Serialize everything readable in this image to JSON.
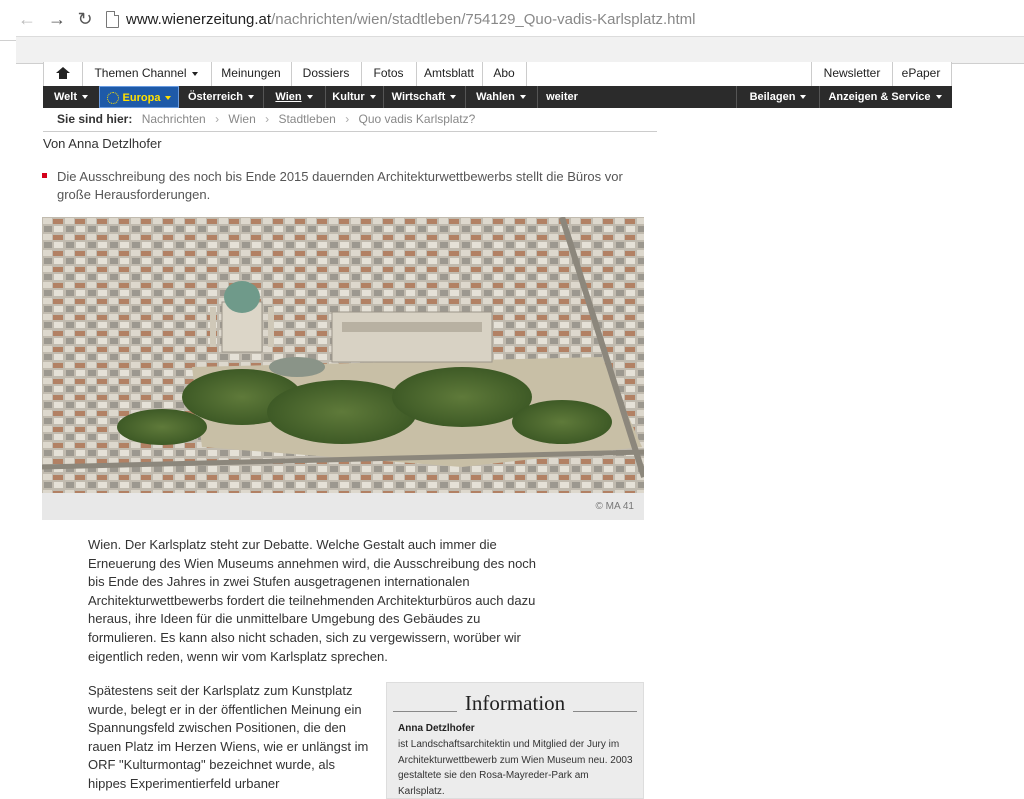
{
  "browser": {
    "url_host": "www.wienerzeitung.at",
    "url_path": "/nachrichten/wien/stadtleben/754129_Quo-vadis-Karlsplatz.html"
  },
  "topnav": {
    "items": [
      "Themen Channel",
      "Meinungen",
      "Dossiers",
      "Fotos",
      "Amtsblatt",
      "Abo"
    ],
    "right": [
      "Newsletter",
      "ePaper"
    ]
  },
  "darknav": {
    "items": [
      "Welt",
      "Europa",
      "Österreich",
      "Wien",
      "Kultur",
      "Wirtschaft",
      "Wahlen",
      "weiter"
    ],
    "right": [
      "Beilagen",
      "Anzeigen & Service"
    ]
  },
  "breadcrumb": {
    "label": "Sie sind hier:",
    "items": [
      "Nachrichten",
      "Wien",
      "Stadtleben",
      "Quo vadis Karlsplatz?"
    ]
  },
  "article": {
    "author": "Von Anna Detzlhofer",
    "teaser": "Die Ausschreibung des noch bis Ende 2015 dauernden Architekturwettbewerbs stellt die Büros vor große Herausforderungen.",
    "photo_credit": "© MA 41",
    "para1": "Wien. Der Karlsplatz steht zur Debatte. Welche Gestalt auch immer die Erneuerung des Wien Museums annehmen wird, die Ausschreibung des noch bis Ende des Jahres in zwei Stufen ausgetragenen internationalen Architekturwettbewerbs fordert die teilnehmenden Architekturbüros auch dazu heraus, ihre Ideen für die unmittelbare Umgebung des Gebäudes zu formulieren. Es kann also nicht schaden, sich zu vergewissern, worüber wir eigentlich reden, wenn wir vom Karlsplatz sprechen.",
    "para2": "Spätestens seit der Karlsplatz zum Kunstplatz wurde, belegt er in der öffentlichen Meinung ein Spannungsfeld zwischen Positionen, die den rauen Platz im Herzen Wiens, wie er unlängst im ORF \"Kulturmontag\" bezeichnet wurde, als hippes Experimentierfeld urbaner"
  },
  "infobox": {
    "title": "Information",
    "name": "Anna Detzlhofer",
    "text": "ist Landschaftsarchitektin und Mitglied der Jury im Architekturwettbewerb zum Wien Museum neu. 2003 gestaltete sie den Rosa-Mayreder-Park am Karlsplatz."
  }
}
